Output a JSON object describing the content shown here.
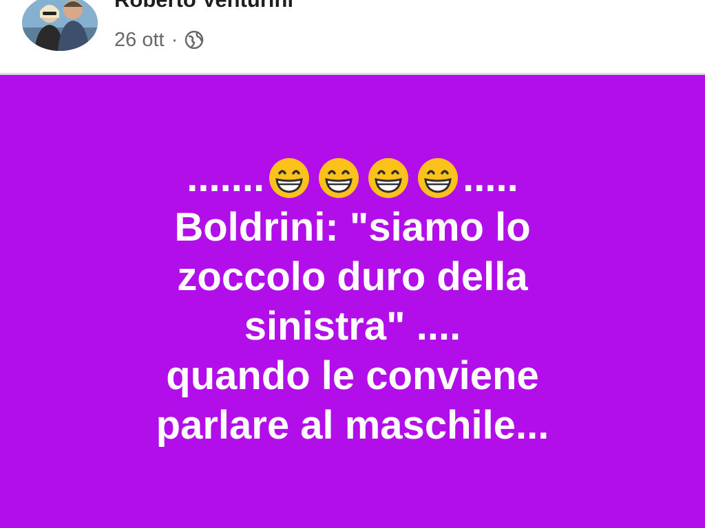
{
  "post": {
    "author_name": "Roberto Venturini",
    "date": "26 ott",
    "separator": "·"
  },
  "icons": {
    "avatar": "profile-photo",
    "privacy": "globe-icon",
    "more": "more-options-icon",
    "emoji": "grinning-face-with-smiling-eyes"
  },
  "content": {
    "leading_dots": ".......",
    "trailing_dots": ".....",
    "emoji_count": 4,
    "lines": [
      "Boldrini: \"siamo lo",
      "zoccolo duro della",
      "sinistra\" ....",
      "quando le conviene",
      "parlare al maschile..."
    ]
  },
  "colors": {
    "post_background": "#b10ee9",
    "text": "#ffffff",
    "header_background": "#ffffff"
  }
}
